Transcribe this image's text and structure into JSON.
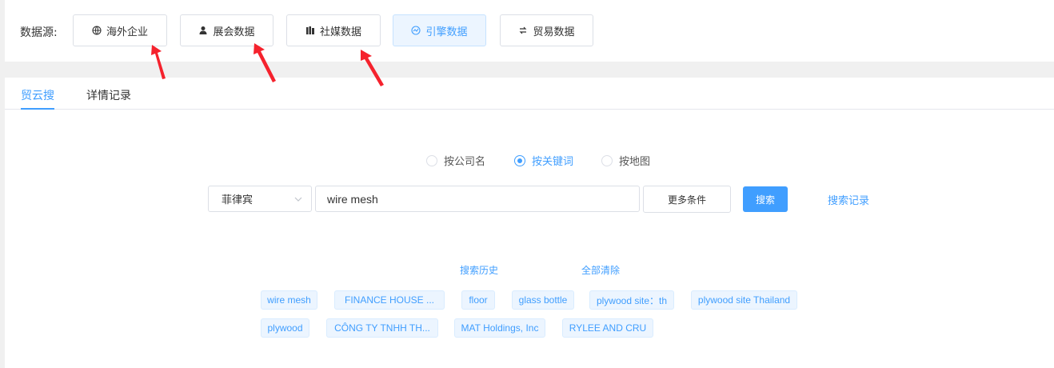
{
  "source_bar": {
    "label": "数据源:",
    "buttons": [
      {
        "label": "海外企业",
        "icon": "globe-icon"
      },
      {
        "label": "展会数据",
        "icon": "user-icon"
      },
      {
        "label": "社媒数据",
        "icon": "books-icon"
      },
      {
        "label": "引擎数据",
        "icon": "engine-icon",
        "active": true
      },
      {
        "label": "贸易数据",
        "icon": "trade-icon"
      }
    ]
  },
  "tabs": [
    {
      "label": "贸云搜",
      "active": true
    },
    {
      "label": "详情记录"
    }
  ],
  "search_mode": {
    "options": [
      "按公司名",
      "按关键词",
      "按地图"
    ],
    "selected": "按关键词"
  },
  "search": {
    "country": "菲律宾",
    "keyword": "wire mesh",
    "more_label": "更多条件",
    "search_label": "搜索",
    "records_label": "搜索记录"
  },
  "history": {
    "title": "搜索历史",
    "clear_label": "全部清除",
    "items": [
      "wire mesh",
      "FINANCE HOUSE ...",
      "floor",
      "glass bottle",
      "plywood site：th",
      "plywood site Thailand",
      "plywood",
      "CÔNG TY TNHH TH...",
      "MAT Holdings, Inc",
      "RYLEE AND CRU"
    ]
  },
  "colors": {
    "accent": "#409eff",
    "annotation_arrow": "#f5222d"
  }
}
